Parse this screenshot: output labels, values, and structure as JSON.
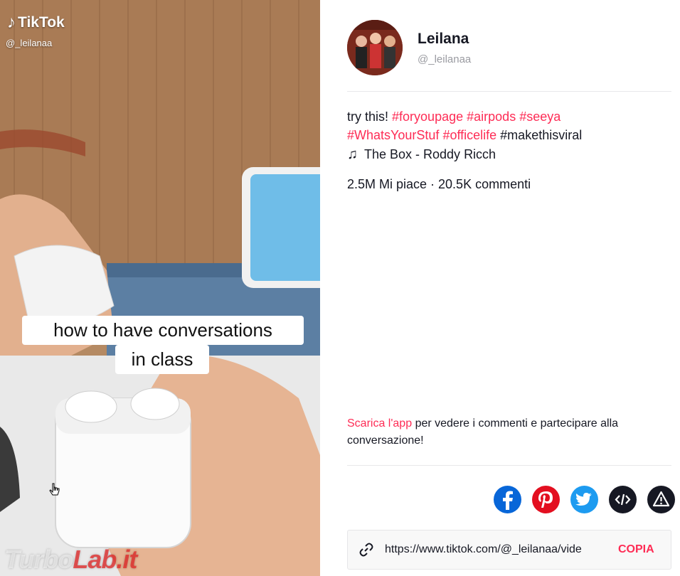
{
  "video": {
    "logo_text": "TikTok",
    "username": "@_leilanaa",
    "caption_line1": "how to have conversations",
    "caption_line2": "in class",
    "watermark_part1": "Turbo",
    "watermark_part2": "Lab.it"
  },
  "profile": {
    "name": "Leilana",
    "handle": "@_leilanaa"
  },
  "post": {
    "text_prefix": "try this!",
    "hashtags": [
      "#foryoupage",
      "#airpods",
      "#seeya",
      "#WhatsYourStuf",
      "#officelife"
    ],
    "trailing_tag": "#makethisviral",
    "music": "The Box - Roddy Ricch",
    "stats": "2.5M Mi piace · 20.5K commenti"
  },
  "comments_prompt": {
    "link_text": "Scarica l'app",
    "text": "per vedere i commenti e partecipare alla conversazione!"
  },
  "share": {
    "buttons": [
      "facebook-icon",
      "pinterest-icon",
      "twitter-icon",
      "embed-icon",
      "report-icon"
    ]
  },
  "copy_link": {
    "url": "https://www.tiktok.com/@_leilanaa/vide",
    "button_label": "COPIA"
  },
  "colors": {
    "accent": "#fe2c55",
    "facebook": "#0866d8",
    "pinterest": "#e30f20",
    "twitter": "#1d9bf0"
  }
}
